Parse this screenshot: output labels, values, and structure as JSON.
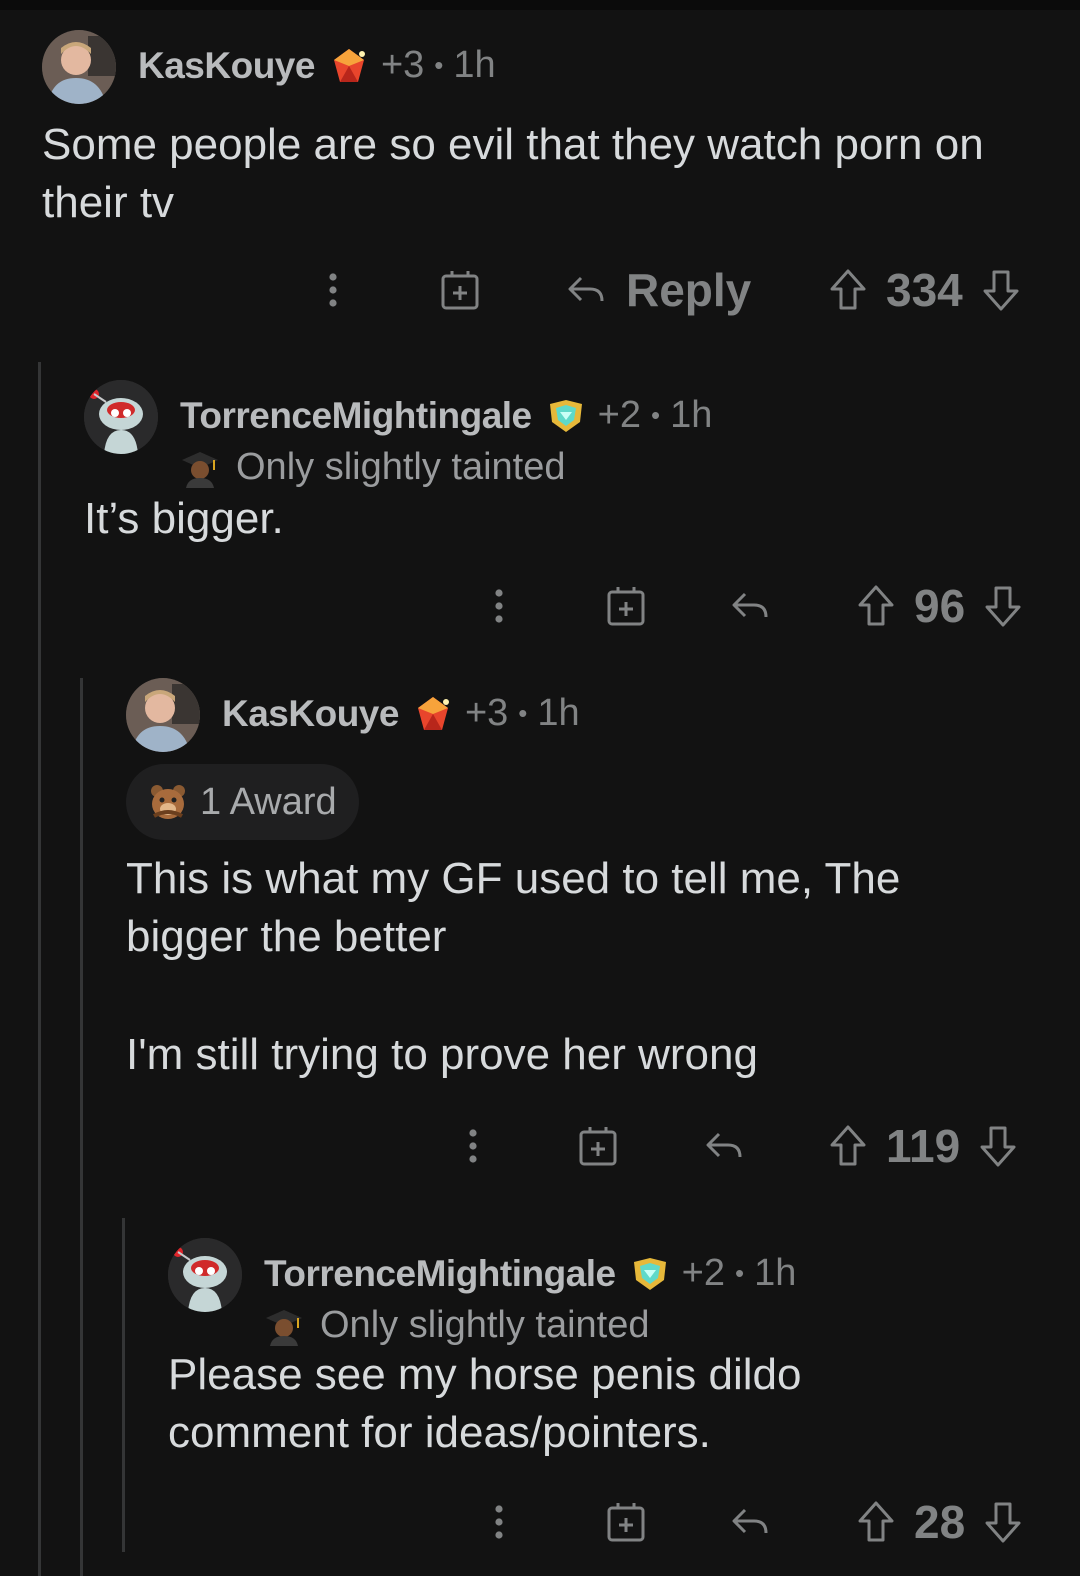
{
  "comments": [
    {
      "username": "KasKouye",
      "karma_badge": "+3",
      "time": "1h",
      "flair_icon": "ruby-gem-icon",
      "subflair": "",
      "award": "",
      "text": "Some people are so evil that they watch porn on their tv",
      "reply_label": "Reply",
      "score": "334"
    },
    {
      "username": "TorrenceMightingale",
      "karma_badge": "+2",
      "time": "1h",
      "flair_icon": "diamond-shield-icon",
      "subflair": "Only slightly tainted",
      "award": "",
      "text": "It’s bigger.",
      "reply_label": "",
      "score": "96"
    },
    {
      "username": "KasKouye",
      "karma_badge": "+3",
      "time": "1h",
      "flair_icon": "ruby-gem-icon",
      "subflair": "",
      "award": "1 Award",
      "text_lines": [
        "This is what my GF used to tell me, The bigger the better",
        "I'm still trying to prove her wrong"
      ],
      "reply_label": "",
      "score": "119"
    },
    {
      "username": "TorrenceMightingale",
      "karma_badge": "+2",
      "time": "1h",
      "flair_icon": "diamond-shield-icon",
      "subflair": "Only slightly tainted",
      "award": "",
      "text": "Please see my horse penis dildo comment for ideas/pointers.",
      "reply_label": "",
      "score": "28"
    }
  ],
  "colors": {
    "background": "#121212",
    "text": "#d7dadc",
    "muted": "#818384",
    "thread_line": "#343536"
  }
}
